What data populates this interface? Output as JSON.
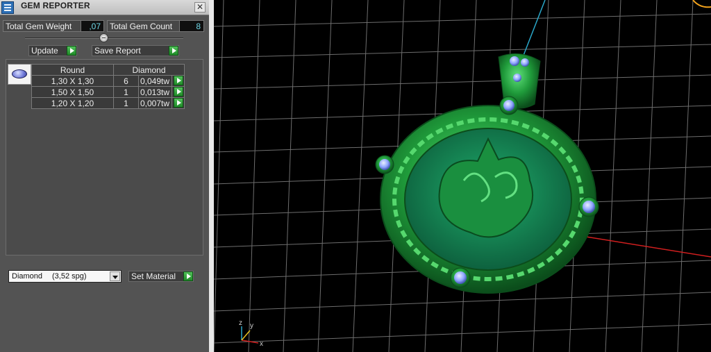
{
  "window": {
    "title": "GEM REPORTER",
    "close_glyph": "✕"
  },
  "stats": {
    "total_weight_label": "Total Gem Weight",
    "total_weight_value": ",07",
    "total_count_label": "Total Gem Count",
    "total_count_value": "8"
  },
  "buttons": {
    "update": "Update",
    "save_report": "Save Report",
    "set_material": "Set Material"
  },
  "table": {
    "header_shape": "Round",
    "header_material": "Diamond",
    "rows": [
      {
        "size": "1,30 X 1,30",
        "count": "6",
        "weight": "0,049tw"
      },
      {
        "size": "1,50 X 1,50",
        "count": "1",
        "weight": "0,013tw"
      },
      {
        "size": "1,20 X 1,20",
        "count": "1",
        "weight": "0,007tw"
      }
    ]
  },
  "material_select": {
    "name": "Diamond",
    "density": "(3,52 spg)"
  },
  "viewport": {
    "axis_labels": {
      "x": "x",
      "y": "y",
      "z": "z"
    },
    "colors": {
      "metal": "#1f9a3a",
      "stone": "#8fa6ff",
      "grid": "#6e6e6e",
      "x_axis": "#d21f1f",
      "y_axis": "#2aa7c9"
    }
  },
  "icons": [
    "app-icon",
    "close-icon",
    "slider-knob",
    "go-arrow-icon",
    "gem-thumbnail-icon",
    "dropdown-arrow-icon",
    "axis-gizmo"
  ]
}
